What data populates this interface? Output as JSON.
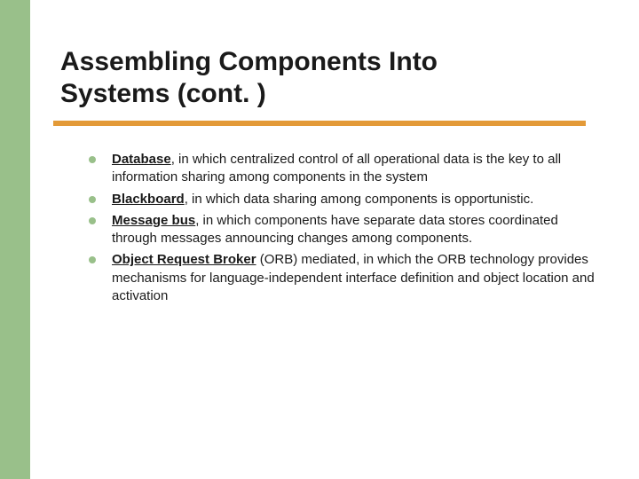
{
  "title_line1": "Assembling Components Into",
  "title_line2": "Systems (cont. )",
  "bullets": [
    {
      "term": "Database",
      "rest": ", in which centralized control of all operational data is the key to all information sharing among components in the system"
    },
    {
      "term": "Blackboard",
      "rest": ", in which data sharing among components is opportunistic."
    },
    {
      "term": "Message bus",
      "rest": ", in which components have separate data stores coordinated through messages announcing changes among components."
    },
    {
      "term": "Object Request Broker",
      "rest": " (ORB) mediated, in which the ORB technology provides mechanisms for language-independent interface definition and object location and activation"
    }
  ]
}
